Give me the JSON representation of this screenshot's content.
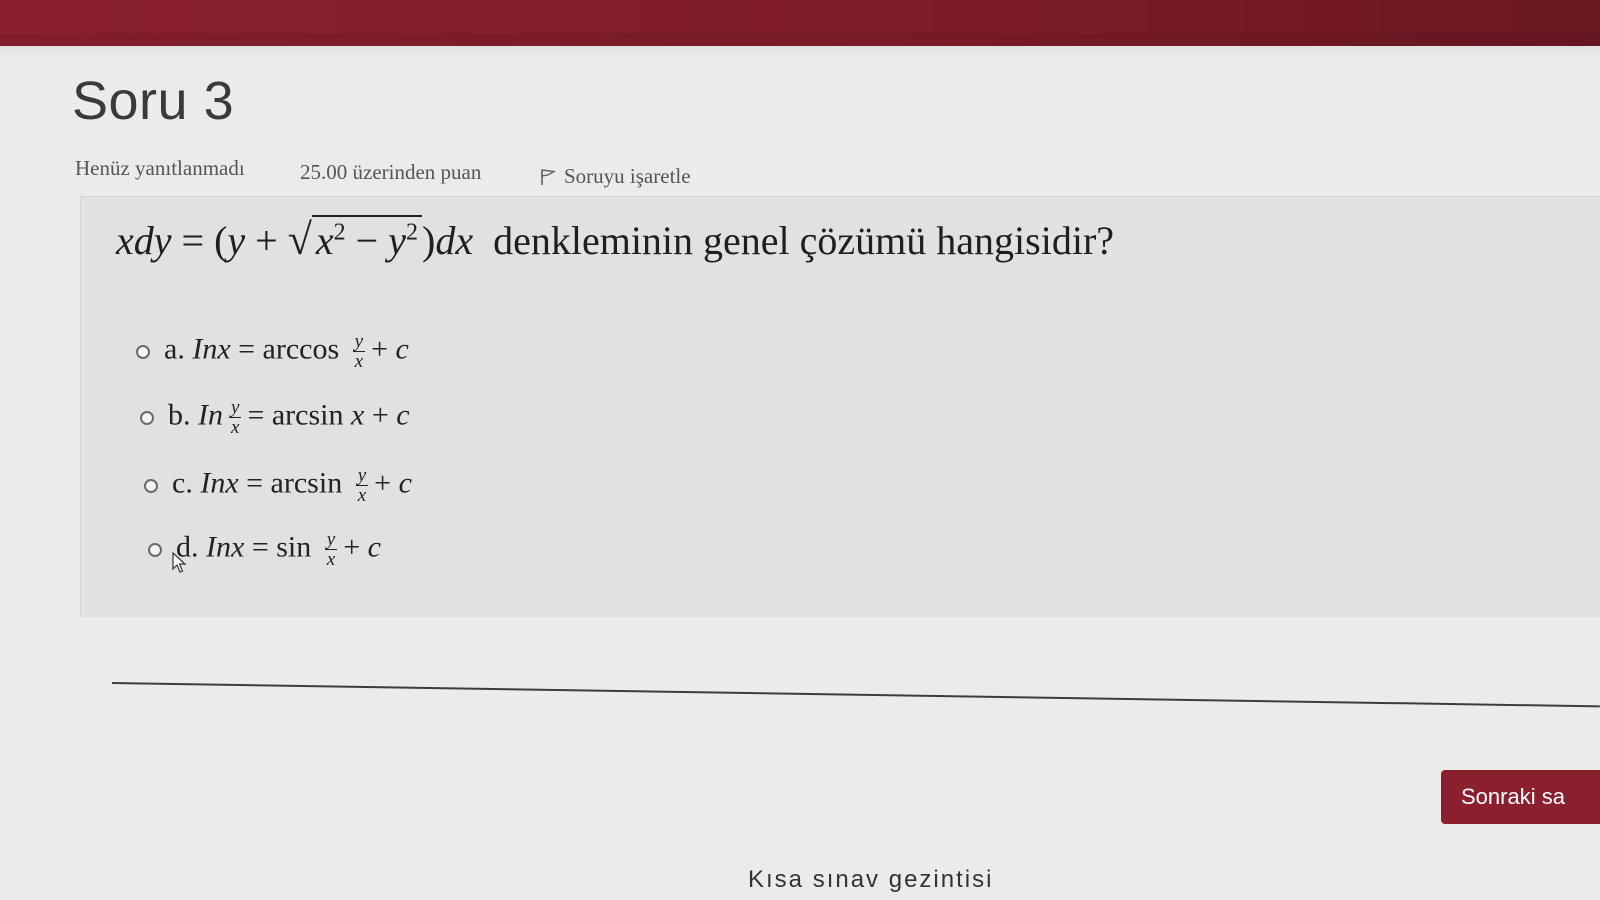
{
  "question": {
    "title": "Soru 3",
    "status": "Henüz yanıtlanmadı",
    "points": "25.00 üzerinden puan",
    "flag_label": "Soruyu işaretle",
    "text_suffix": "denkleminin genel çözümü hangisidir?"
  },
  "options": [
    {
      "label": "a."
    },
    {
      "label": "b."
    },
    {
      "label": "c."
    },
    {
      "label": "d."
    }
  ],
  "footer": {
    "next_label": "Sonraki sa",
    "nav_label": "Kısa sınav gezintisi"
  },
  "colors": {
    "brand": "#8a1f2e",
    "background": "#ebebea",
    "question_box": "#e1e1df"
  },
  "icons": {
    "flag": "flag-icon",
    "cursor": "mouse-pointer-icon"
  }
}
